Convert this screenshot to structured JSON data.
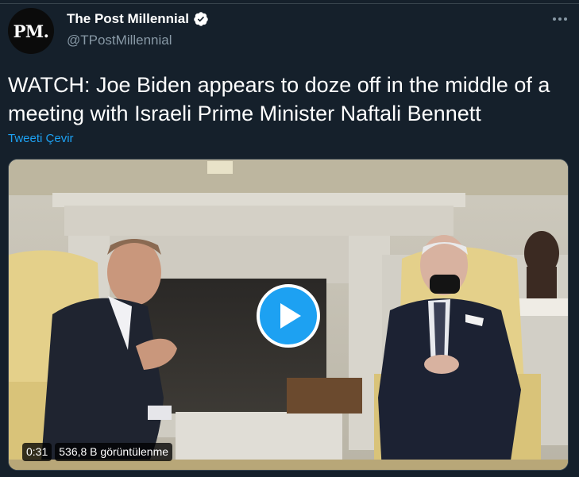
{
  "account": {
    "avatar_text": "PM.",
    "display_name": "The Post Millennial",
    "handle": "@TPostMillennial"
  },
  "tweet": {
    "text": "WATCH: Joe Biden appears to doze off in the middle of a meeting with Israeli Prime Minister Naftali Bennett",
    "translate_label": "Tweeti Çevir"
  },
  "video": {
    "duration": "0:31",
    "views": "536,8 B görüntülenme"
  },
  "icons": {
    "verified": "verified-badge-icon",
    "more": "more-options-icon",
    "play": "play-icon"
  },
  "colors": {
    "background": "#15202b",
    "accent": "#1da1f2",
    "secondary_text": "#8899a6"
  }
}
